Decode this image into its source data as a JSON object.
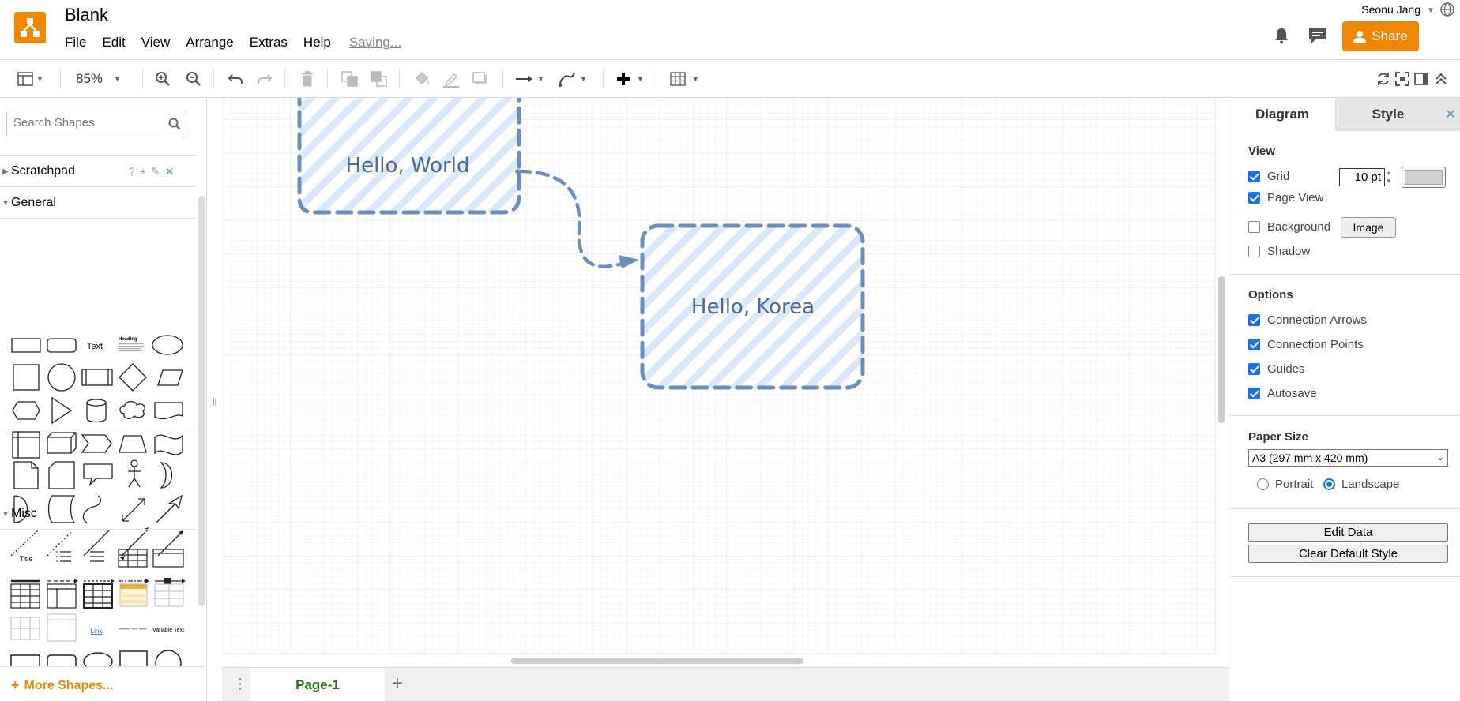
{
  "header": {
    "title": "Blank",
    "menus": [
      "File",
      "Edit",
      "View",
      "Arrange",
      "Extras",
      "Help"
    ],
    "saving": "Saving...",
    "user": "Seonu Jang",
    "share_label": "Share",
    "brand_color": "#f08705"
  },
  "toolbar": {
    "zoom": "85%"
  },
  "sidebar": {
    "search_placeholder": "Search Shapes",
    "scratchpad": "Scratchpad",
    "scratchpad_icons": [
      "?",
      "+",
      "✎",
      "✕"
    ],
    "general": "General",
    "misc": "Misc",
    "more_shapes": "More Shapes...",
    "text_shape": "Text",
    "heading_shape": "Heading",
    "title_shape": "Title",
    "link_shape": "Link",
    "variable_shape": "Variable Text"
  },
  "canvas": {
    "shape1": "Hello, World",
    "shape2": "Hello, Korea",
    "shape_stroke": "#6c8ebf",
    "shape_fill": "#dae8fc"
  },
  "pages": {
    "tab": "Page-1",
    "add": "+"
  },
  "panel": {
    "tab_diagram": "Diagram",
    "tab_style": "Style",
    "view_header": "View",
    "grid": "Grid",
    "grid_size": "10 pt",
    "page_view": "Page View",
    "background": "Background",
    "image_button": "Image",
    "shadow": "Shadow",
    "options_header": "Options",
    "connection_arrows": "Connection Arrows",
    "connection_points": "Connection Points",
    "guides": "Guides",
    "autosave": "Autosave",
    "paper_size_header": "Paper Size",
    "paper_size": "A3 (297 mm x 420 mm)",
    "portrait": "Portrait",
    "landscape": "Landscape",
    "edit_data": "Edit Data",
    "clear_default_style": "Clear Default Style"
  }
}
